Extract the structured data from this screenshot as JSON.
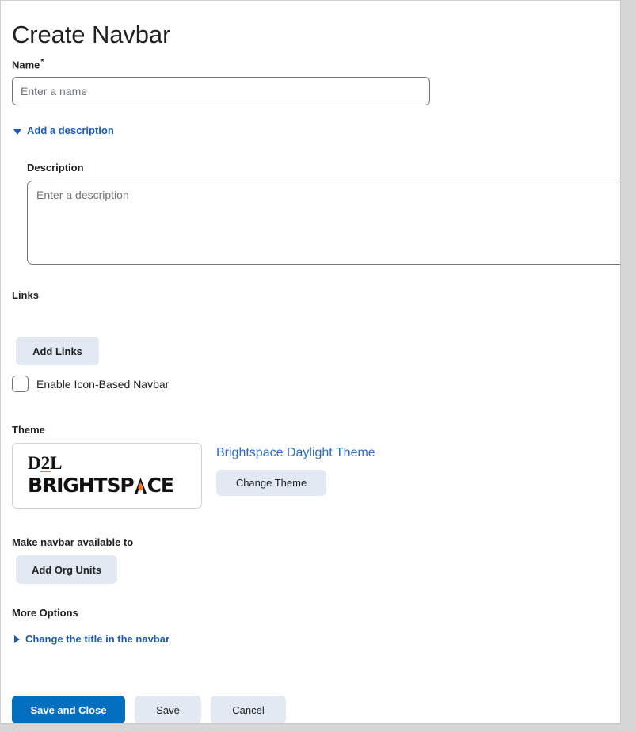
{
  "page": {
    "title": "Create Navbar"
  },
  "name_field": {
    "label": "Name",
    "required_marker": "*",
    "placeholder": "Enter a name",
    "value": ""
  },
  "description_section": {
    "toggle_label": "Add a description",
    "toggle_icon": "triangle-down-icon",
    "expanded": true,
    "label": "Description",
    "placeholder": "Enter a description",
    "value": ""
  },
  "links_section": {
    "label": "Links",
    "add_links_label": "Add Links",
    "icon_navbar_checkbox_label": "Enable Icon-Based Navbar",
    "icon_navbar_checked": false
  },
  "theme_section": {
    "label": "Theme",
    "thumbnail_logo_top": "D2L",
    "thumbnail_logo_bottom": "BRIGHTSPACE",
    "theme_name": "Brightspace Daylight Theme",
    "change_theme_label": "Change Theme"
  },
  "availability_section": {
    "label": "Make navbar available to",
    "add_org_units_label": "Add Org Units"
  },
  "more_options_section": {
    "label": "More Options",
    "change_title_label": "Change the title in the navbar",
    "change_title_icon": "triangle-right-icon",
    "expanded": false
  },
  "footer": {
    "save_and_close_label": "Save and Close",
    "save_label": "Save",
    "cancel_label": "Cancel"
  },
  "colors": {
    "primary_blue": "#006fbf",
    "link_blue": "#2d6cc0",
    "disclosure_blue": "#1f5bb0",
    "secondary_button_bg": "#e2e9f2",
    "text": "#202122",
    "border": "#6e7477",
    "brand_orange": "#ef7622",
    "page_bg": "#ffffff",
    "outer_bg": "#d6d6d6"
  }
}
